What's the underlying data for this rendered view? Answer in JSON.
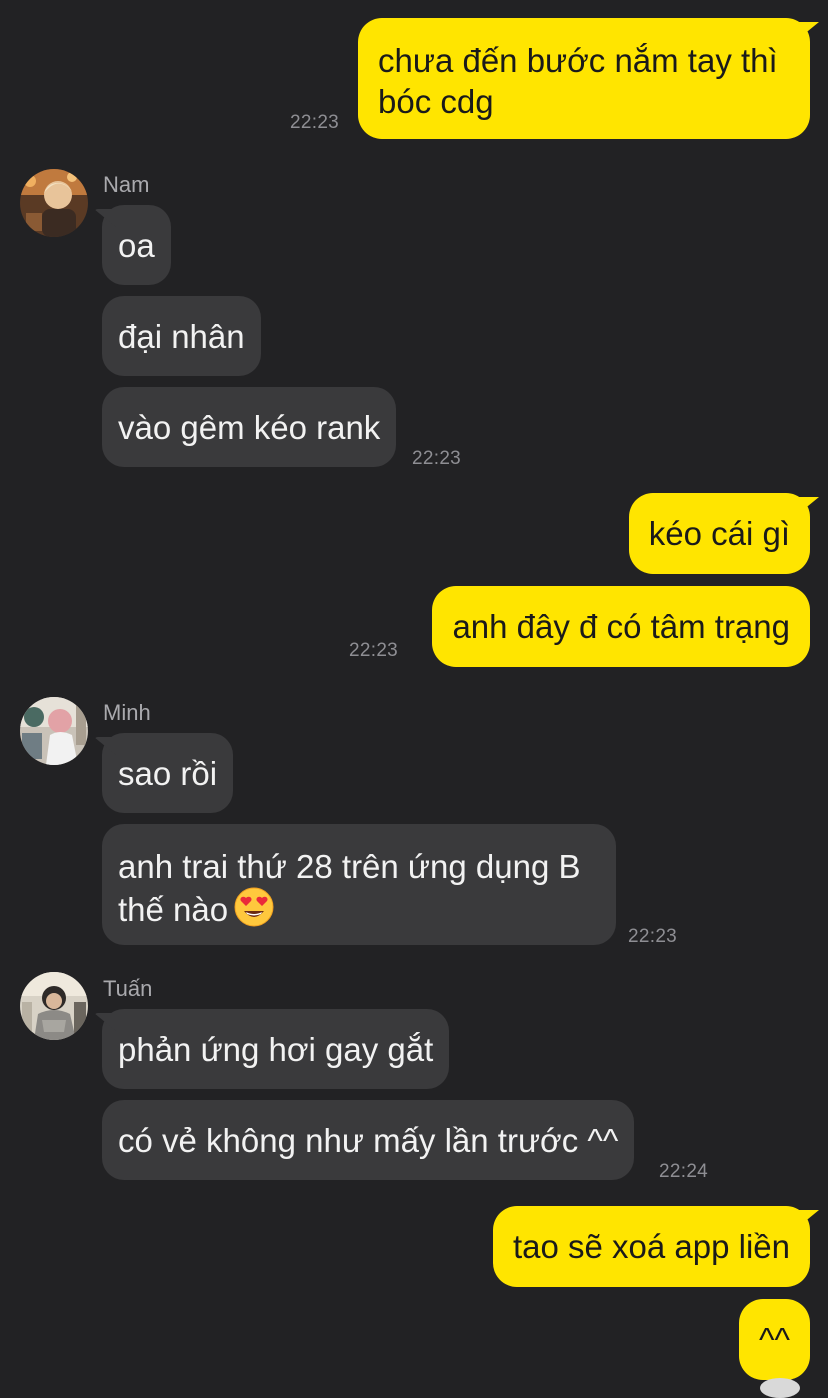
{
  "chat": {
    "messages": [
      {
        "direction": "out",
        "lines": [
          "chưa đến bước nắm tay thì",
          "bóc cdg"
        ],
        "time": "22:23"
      },
      {
        "direction": "in",
        "sender": "Nam",
        "texts": [
          "oa",
          "đại nhân",
          "vào gêm kéo rank"
        ],
        "time": "22:23"
      },
      {
        "direction": "out",
        "texts": [
          "kéo cái gì",
          "anh đây đ có tâm trạng"
        ],
        "time": "22:23"
      },
      {
        "direction": "in",
        "sender": "Minh",
        "texts": [
          "sao rồi"
        ],
        "multiline": [
          "anh trai thứ 28 trên ứng dụng B",
          "thế nào"
        ],
        "emoji": "heart-eyes",
        "time": "22:23"
      },
      {
        "direction": "in",
        "sender": "Tuấn",
        "texts": [
          "phản ứng hơi gay gắt",
          "có vẻ không như mấy lần trước ^^"
        ],
        "time": "22:24"
      },
      {
        "direction": "out",
        "texts": [
          "tao sẽ xoá app liền",
          "^^"
        ]
      }
    ]
  },
  "colors": {
    "background": "#222224",
    "incoming_bubble": "#3a3a3c",
    "outgoing_bubble": "#ffe500",
    "timestamp": "#8e8e93"
  }
}
